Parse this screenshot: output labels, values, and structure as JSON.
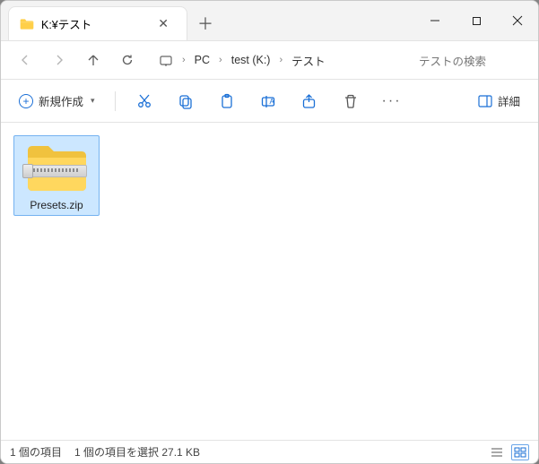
{
  "tab": {
    "title": "K:¥テスト"
  },
  "breadcrumbs": [
    "PC",
    "test (K:)",
    "テスト"
  ],
  "search": {
    "placeholder": "テストの検索"
  },
  "toolbar": {
    "new_label": "新規作成",
    "details_label": "詳細"
  },
  "items": [
    {
      "name": "Presets.zip"
    }
  ],
  "status": {
    "count": "1 個の項目",
    "selection": "1 個の項目を選択 27.1 KB"
  }
}
